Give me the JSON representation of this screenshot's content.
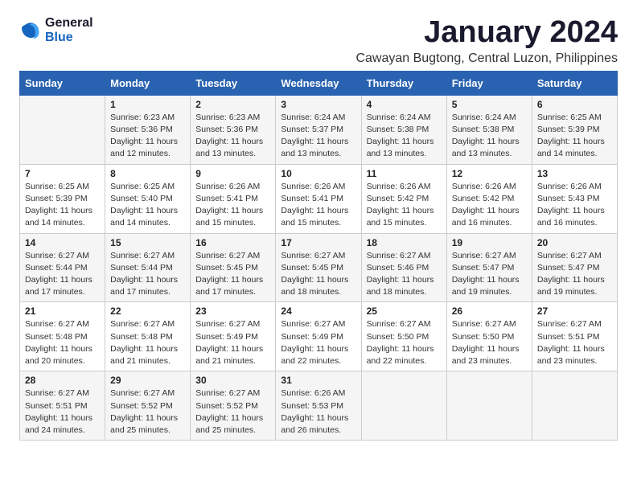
{
  "logo": {
    "line1": "General",
    "line2": "Blue"
  },
  "title": "January 2024",
  "subtitle": "Cawayan Bugtong, Central Luzon, Philippines",
  "days": [
    "Sunday",
    "Monday",
    "Tuesday",
    "Wednesday",
    "Thursday",
    "Friday",
    "Saturday"
  ],
  "weeks": [
    [
      {
        "num": "",
        "text": ""
      },
      {
        "num": "1",
        "text": "Sunrise: 6:23 AM\nSunset: 5:36 PM\nDaylight: 11 hours\nand 12 minutes."
      },
      {
        "num": "2",
        "text": "Sunrise: 6:23 AM\nSunset: 5:36 PM\nDaylight: 11 hours\nand 13 minutes."
      },
      {
        "num": "3",
        "text": "Sunrise: 6:24 AM\nSunset: 5:37 PM\nDaylight: 11 hours\nand 13 minutes."
      },
      {
        "num": "4",
        "text": "Sunrise: 6:24 AM\nSunset: 5:38 PM\nDaylight: 11 hours\nand 13 minutes."
      },
      {
        "num": "5",
        "text": "Sunrise: 6:24 AM\nSunset: 5:38 PM\nDaylight: 11 hours\nand 13 minutes."
      },
      {
        "num": "6",
        "text": "Sunrise: 6:25 AM\nSunset: 5:39 PM\nDaylight: 11 hours\nand 14 minutes."
      }
    ],
    [
      {
        "num": "7",
        "text": "Sunrise: 6:25 AM\nSunset: 5:39 PM\nDaylight: 11 hours\nand 14 minutes."
      },
      {
        "num": "8",
        "text": "Sunrise: 6:25 AM\nSunset: 5:40 PM\nDaylight: 11 hours\nand 14 minutes."
      },
      {
        "num": "9",
        "text": "Sunrise: 6:26 AM\nSunset: 5:41 PM\nDaylight: 11 hours\nand 15 minutes."
      },
      {
        "num": "10",
        "text": "Sunrise: 6:26 AM\nSunset: 5:41 PM\nDaylight: 11 hours\nand 15 minutes."
      },
      {
        "num": "11",
        "text": "Sunrise: 6:26 AM\nSunset: 5:42 PM\nDaylight: 11 hours\nand 15 minutes."
      },
      {
        "num": "12",
        "text": "Sunrise: 6:26 AM\nSunset: 5:42 PM\nDaylight: 11 hours\nand 16 minutes."
      },
      {
        "num": "13",
        "text": "Sunrise: 6:26 AM\nSunset: 5:43 PM\nDaylight: 11 hours\nand 16 minutes."
      }
    ],
    [
      {
        "num": "14",
        "text": "Sunrise: 6:27 AM\nSunset: 5:44 PM\nDaylight: 11 hours\nand 17 minutes."
      },
      {
        "num": "15",
        "text": "Sunrise: 6:27 AM\nSunset: 5:44 PM\nDaylight: 11 hours\nand 17 minutes."
      },
      {
        "num": "16",
        "text": "Sunrise: 6:27 AM\nSunset: 5:45 PM\nDaylight: 11 hours\nand 17 minutes."
      },
      {
        "num": "17",
        "text": "Sunrise: 6:27 AM\nSunset: 5:45 PM\nDaylight: 11 hours\nand 18 minutes."
      },
      {
        "num": "18",
        "text": "Sunrise: 6:27 AM\nSunset: 5:46 PM\nDaylight: 11 hours\nand 18 minutes."
      },
      {
        "num": "19",
        "text": "Sunrise: 6:27 AM\nSunset: 5:47 PM\nDaylight: 11 hours\nand 19 minutes."
      },
      {
        "num": "20",
        "text": "Sunrise: 6:27 AM\nSunset: 5:47 PM\nDaylight: 11 hours\nand 19 minutes."
      }
    ],
    [
      {
        "num": "21",
        "text": "Sunrise: 6:27 AM\nSunset: 5:48 PM\nDaylight: 11 hours\nand 20 minutes."
      },
      {
        "num": "22",
        "text": "Sunrise: 6:27 AM\nSunset: 5:48 PM\nDaylight: 11 hours\nand 21 minutes."
      },
      {
        "num": "23",
        "text": "Sunrise: 6:27 AM\nSunset: 5:49 PM\nDaylight: 11 hours\nand 21 minutes."
      },
      {
        "num": "24",
        "text": "Sunrise: 6:27 AM\nSunset: 5:49 PM\nDaylight: 11 hours\nand 22 minutes."
      },
      {
        "num": "25",
        "text": "Sunrise: 6:27 AM\nSunset: 5:50 PM\nDaylight: 11 hours\nand 22 minutes."
      },
      {
        "num": "26",
        "text": "Sunrise: 6:27 AM\nSunset: 5:50 PM\nDaylight: 11 hours\nand 23 minutes."
      },
      {
        "num": "27",
        "text": "Sunrise: 6:27 AM\nSunset: 5:51 PM\nDaylight: 11 hours\nand 23 minutes."
      }
    ],
    [
      {
        "num": "28",
        "text": "Sunrise: 6:27 AM\nSunset: 5:51 PM\nDaylight: 11 hours\nand 24 minutes."
      },
      {
        "num": "29",
        "text": "Sunrise: 6:27 AM\nSunset: 5:52 PM\nDaylight: 11 hours\nand 25 minutes."
      },
      {
        "num": "30",
        "text": "Sunrise: 6:27 AM\nSunset: 5:52 PM\nDaylight: 11 hours\nand 25 minutes."
      },
      {
        "num": "31",
        "text": "Sunrise: 6:26 AM\nSunset: 5:53 PM\nDaylight: 11 hours\nand 26 minutes."
      },
      {
        "num": "",
        "text": ""
      },
      {
        "num": "",
        "text": ""
      },
      {
        "num": "",
        "text": ""
      }
    ]
  ]
}
